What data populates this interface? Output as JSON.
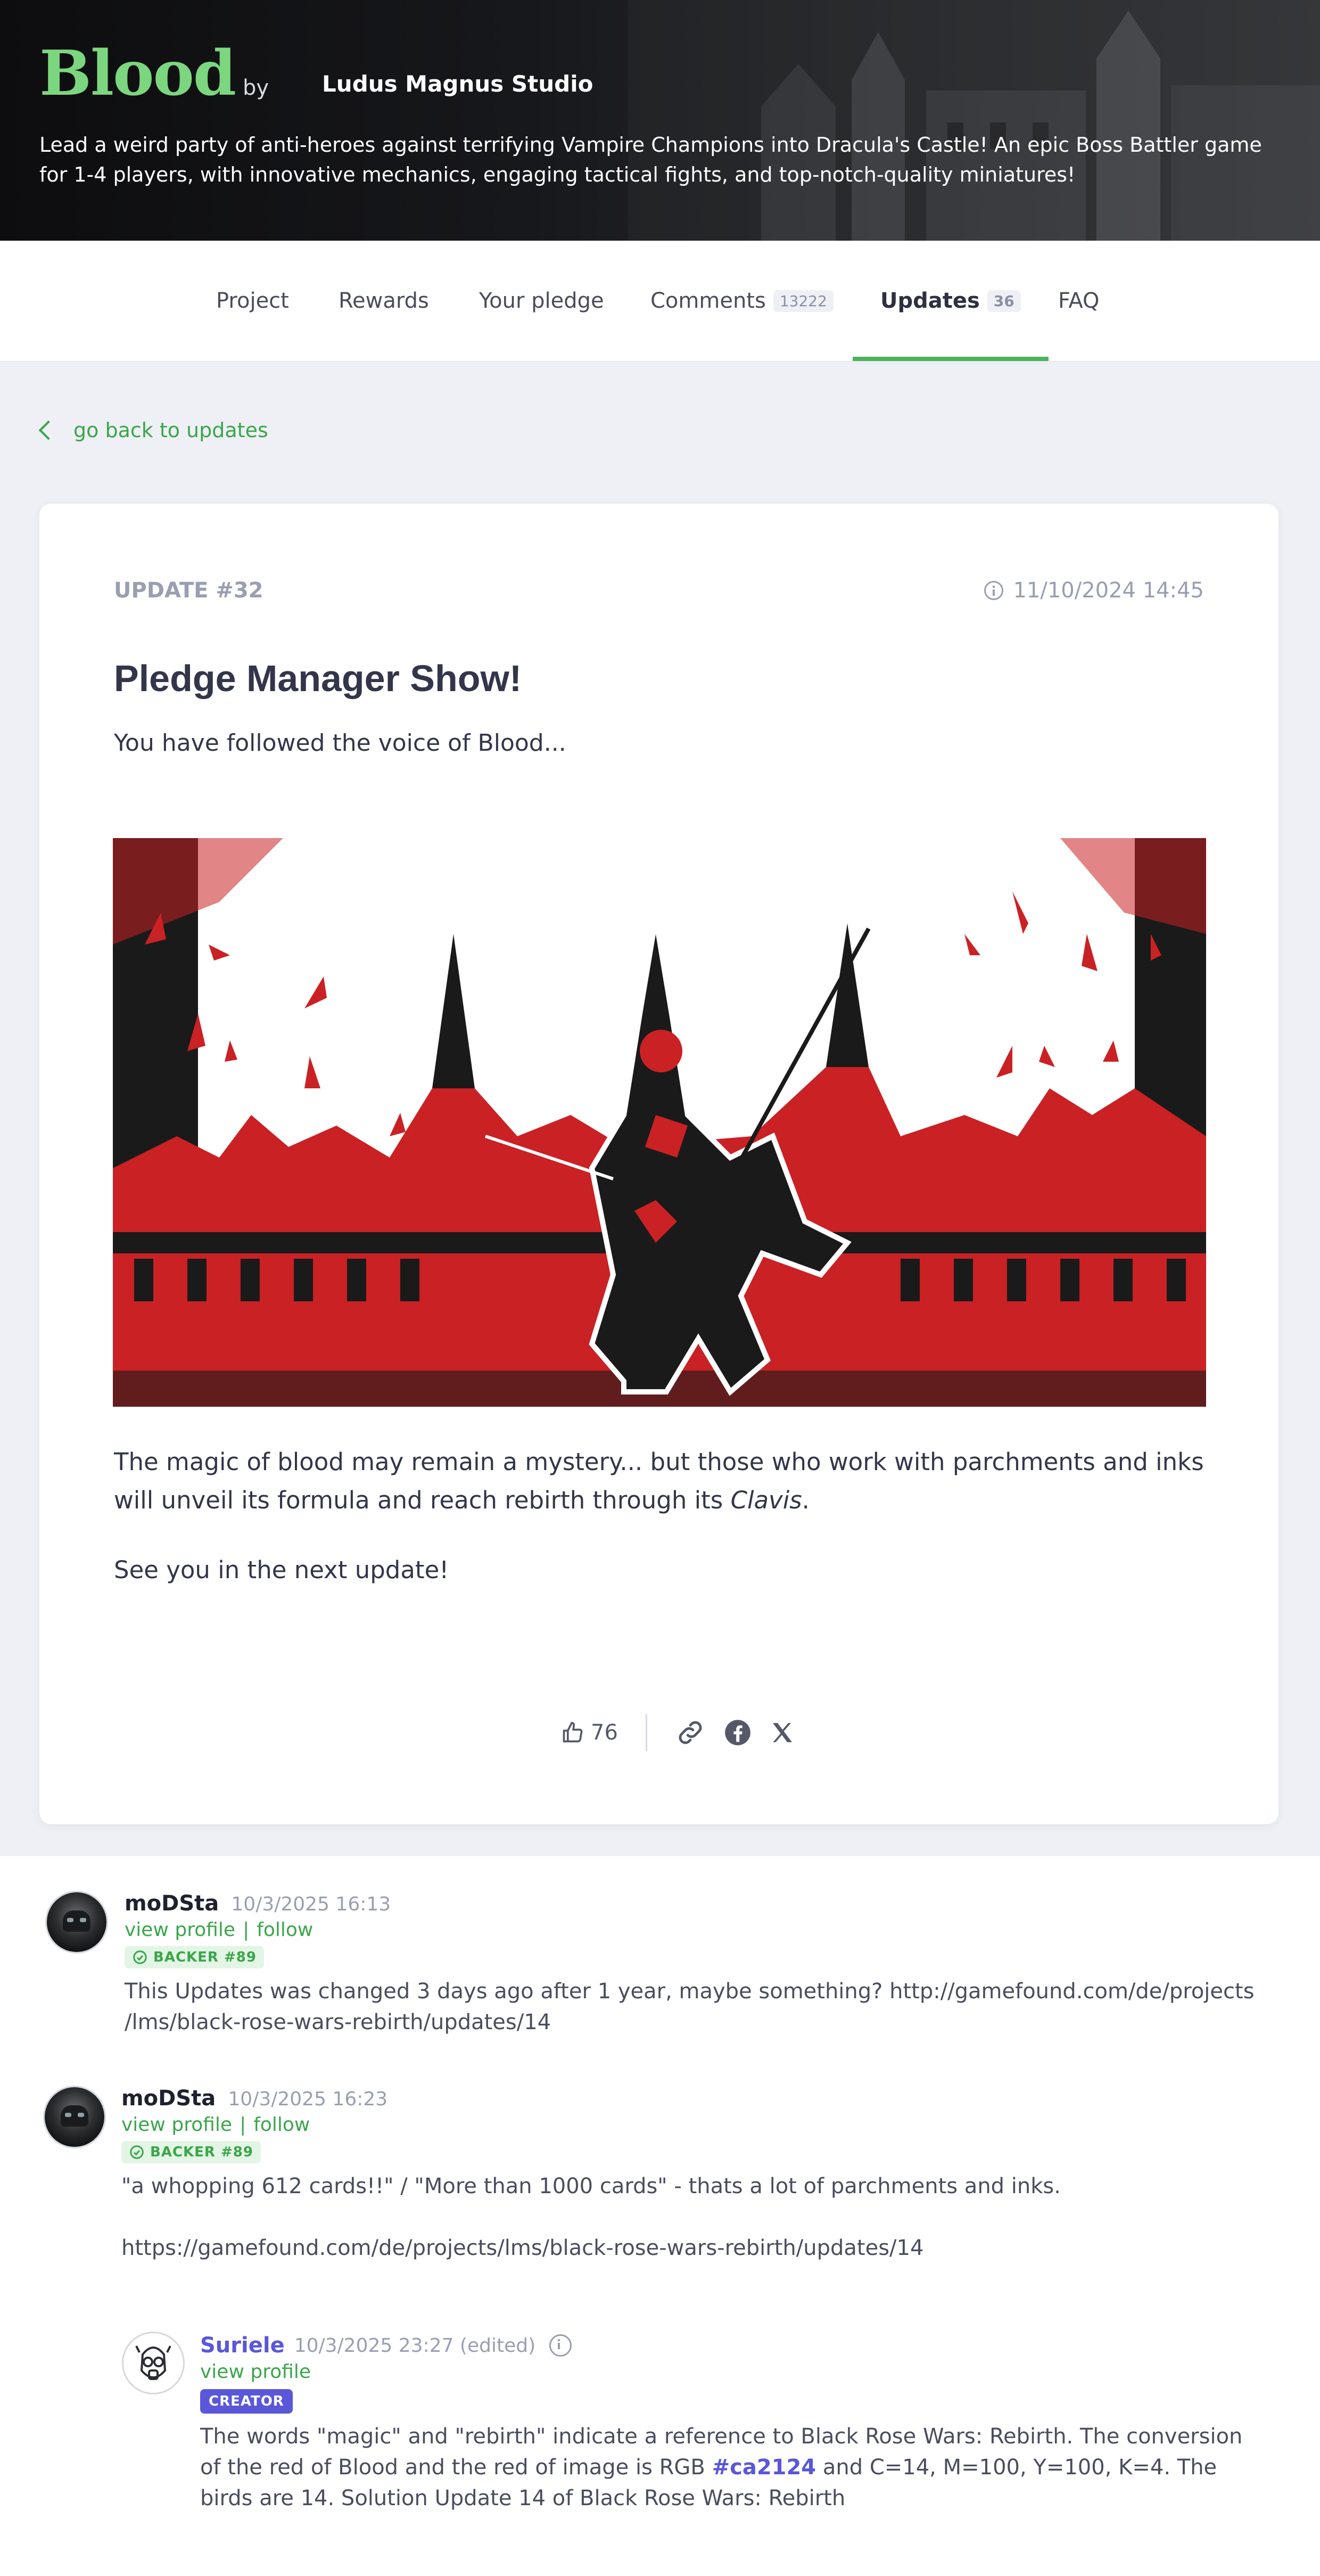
{
  "header": {
    "logo": "Blood",
    "by": "by",
    "studio": "Ludus Magnus Studio",
    "tagline": "Lead a weird party of anti-heroes against terrifying Vampire Champions into Dracula's Castle! An epic Boss Battler game for 1-4 players, with innovative mechanics, engaging tactical fights, and top-notch-quality miniatures!"
  },
  "tabs": {
    "project": "Project",
    "rewards": "Rewards",
    "your_pledge": "Your pledge",
    "comments": "Comments",
    "comments_count": "13222",
    "updates": "Updates",
    "updates_count": "36",
    "faq": "FAQ",
    "active": "updates"
  },
  "back_link": "go back to updates",
  "update": {
    "number": "UPDATE #32",
    "date": "11/10/2024 14:45",
    "title": "Pledge Manager Show!",
    "intro": "You have followed the voice of Blood...",
    "body_part1": "The magic of blood may remain a mystery... but those who work with parchments and inks will unveil its formula and reach rebirth through its ",
    "body_italic": "Clavis",
    "body_part2": ".",
    "closing": "See you in the next update!",
    "likes": "76"
  },
  "colors": {
    "brand_green": "#7cd67f",
    "accent_green": "#4bb45a",
    "illustration_red": "#ca2124",
    "creator_purple": "#5a57d9"
  },
  "icons": [
    "thumbs-up-icon",
    "link-icon",
    "facebook-icon",
    "x-icon",
    "info-icon",
    "chevron-left-icon"
  ],
  "comments": [
    {
      "author": "moDSta",
      "time": "10/3/2025 16:13",
      "view_profile": "view profile",
      "separator": "|",
      "follow": "follow",
      "badge": "BACKER #89",
      "text": "This Updates was changed 3 days ago after 1 year, maybe something? http://gamefound.com/de/projects /lms/black-rose-wars-rebirth/updates/14"
    },
    {
      "author": "moDSta",
      "time": "10/3/2025 16:23",
      "view_profile": "view profile",
      "separator": "|",
      "follow": "follow",
      "badge": "BACKER #89",
      "text_line1": "\"a whopping 612 cards!!\" / \"More than 1000 cards\" - thats a lot of parchments and inks.",
      "text_line2": "https://gamefound.com/de/projects/lms/black-rose-wars-rebirth/updates/14"
    },
    {
      "author": "Suriele",
      "time": "10/3/2025 23:27 (edited)",
      "view_profile": "view profile",
      "badge": "CREATOR",
      "text_part1": "The words \"magic\" and \"rebirth\" indicate a reference to Black Rose Wars: Rebirth. The conversion of the red of Blood and the red of image is RGB ",
      "text_hex": "#ca2124",
      "text_part2": " and C=14, M=100, Y=100, K=4. The birds are 14. Solution Update 14 of Black Rose Wars: Rebirth"
    }
  ]
}
